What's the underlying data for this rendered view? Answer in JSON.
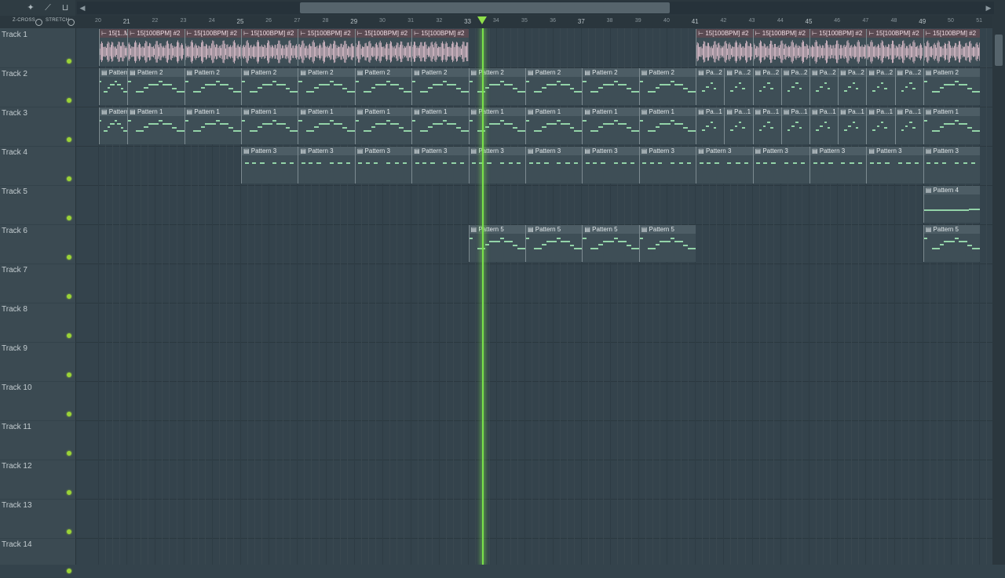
{
  "toolbar": {
    "tools": [
      "magnet-icon",
      "pencil-icon",
      "slice-icon"
    ],
    "crossfade_label": "Z-CROSS",
    "stretch_label": "STRETCH"
  },
  "ruler": {
    "first_bar": 20,
    "last_bar": 51,
    "bar_labels": [
      "20",
      "21",
      "22",
      "23",
      "24",
      "25",
      "26",
      "27",
      "28",
      "29",
      "30",
      "31",
      "32",
      "33",
      "34",
      "35",
      "36",
      "37",
      "38",
      "39",
      "40",
      "41",
      "42",
      "43",
      "44",
      "45",
      "46",
      "47",
      "48",
      "49",
      "50",
      "51"
    ],
    "playhead_bar": 33.5
  },
  "scroll": {
    "thumb_start_bar": 27,
    "thumb_end_bar": 40
  },
  "tracks": [
    {
      "label": "Track 1"
    },
    {
      "label": "Track 2"
    },
    {
      "label": "Track 3"
    },
    {
      "label": "Track 4"
    },
    {
      "label": "Track 5"
    },
    {
      "label": "Track 6"
    },
    {
      "label": "Track 7"
    },
    {
      "label": "Track 8"
    },
    {
      "label": "Track 9"
    },
    {
      "label": "Track 10"
    },
    {
      "label": "Track 11"
    },
    {
      "label": "Track 12"
    },
    {
      "label": "Track 13"
    },
    {
      "label": "Track 14"
    }
  ],
  "clips": [
    {
      "track": 0,
      "start": 20,
      "end": 21,
      "title": "15[1..M] #2",
      "type": "audio"
    },
    {
      "track": 0,
      "start": 21,
      "end": 23,
      "title": "15[100BPM] #2",
      "type": "audio"
    },
    {
      "track": 0,
      "start": 23,
      "end": 25,
      "title": "15[100BPM] #2",
      "type": "audio"
    },
    {
      "track": 0,
      "start": 25,
      "end": 27,
      "title": "15[100BPM] #2",
      "type": "audio"
    },
    {
      "track": 0,
      "start": 27,
      "end": 29,
      "title": "15[100BPM] #2",
      "type": "audio"
    },
    {
      "track": 0,
      "start": 29,
      "end": 31,
      "title": "15[100BPM] #2",
      "type": "audio"
    },
    {
      "track": 0,
      "start": 31,
      "end": 33,
      "title": "15[100BPM] #2",
      "type": "audio"
    },
    {
      "track": 0,
      "start": 41,
      "end": 43,
      "title": "15[100BPM] #2",
      "type": "audio"
    },
    {
      "track": 0,
      "start": 43,
      "end": 45,
      "title": "15[100BPM] #2",
      "type": "audio"
    },
    {
      "track": 0,
      "start": 45,
      "end": 47,
      "title": "15[100BPM] #2",
      "type": "audio"
    },
    {
      "track": 0,
      "start": 47,
      "end": 49,
      "title": "15[100BPM] #2",
      "type": "audio"
    },
    {
      "track": 0,
      "start": 49,
      "end": 51,
      "title": "15[100BPM] #2",
      "type": "audio"
    },
    {
      "track": 1,
      "start": 20,
      "end": 21,
      "title": "Pattern 2",
      "type": "pattern",
      "pattern": "a"
    },
    {
      "track": 1,
      "start": 21,
      "end": 23,
      "title": "Pattern 2",
      "type": "pattern",
      "pattern": "a"
    },
    {
      "track": 1,
      "start": 23,
      "end": 25,
      "title": "Pattern 2",
      "type": "pattern",
      "pattern": "a"
    },
    {
      "track": 1,
      "start": 25,
      "end": 27,
      "title": "Pattern 2",
      "type": "pattern",
      "pattern": "a"
    },
    {
      "track": 1,
      "start": 27,
      "end": 29,
      "title": "Pattern 2",
      "type": "pattern",
      "pattern": "a"
    },
    {
      "track": 1,
      "start": 29,
      "end": 31,
      "title": "Pattern 2",
      "type": "pattern",
      "pattern": "a"
    },
    {
      "track": 1,
      "start": 31,
      "end": 33,
      "title": "Pattern 2",
      "type": "pattern",
      "pattern": "a"
    },
    {
      "track": 1,
      "start": 33,
      "end": 35,
      "title": "Pattern 2",
      "type": "pattern",
      "pattern": "a"
    },
    {
      "track": 1,
      "start": 35,
      "end": 37,
      "title": "Pattern 2",
      "type": "pattern",
      "pattern": "a"
    },
    {
      "track": 1,
      "start": 37,
      "end": 39,
      "title": "Pattern 2",
      "type": "pattern",
      "pattern": "a"
    },
    {
      "track": 1,
      "start": 39,
      "end": 41,
      "title": "Pattern 2",
      "type": "pattern",
      "pattern": "a"
    },
    {
      "track": 1,
      "start": 41,
      "end": 42,
      "title": "Pa...2",
      "type": "pattern",
      "pattern": "b"
    },
    {
      "track": 1,
      "start": 42,
      "end": 43,
      "title": "Pa...2",
      "type": "pattern",
      "pattern": "b"
    },
    {
      "track": 1,
      "start": 43,
      "end": 44,
      "title": "Pa...2",
      "type": "pattern",
      "pattern": "b"
    },
    {
      "track": 1,
      "start": 44,
      "end": 45,
      "title": "Pa...2",
      "type": "pattern",
      "pattern": "b"
    },
    {
      "track": 1,
      "start": 45,
      "end": 46,
      "title": "Pa...2",
      "type": "pattern",
      "pattern": "b"
    },
    {
      "track": 1,
      "start": 46,
      "end": 47,
      "title": "Pa...2",
      "type": "pattern",
      "pattern": "b"
    },
    {
      "track": 1,
      "start": 47,
      "end": 48,
      "title": "Pa...2",
      "type": "pattern",
      "pattern": "b"
    },
    {
      "track": 1,
      "start": 48,
      "end": 49,
      "title": "Pa...2",
      "type": "pattern",
      "pattern": "b"
    },
    {
      "track": 1,
      "start": 49,
      "end": 51,
      "title": "Pattern 2",
      "type": "pattern",
      "pattern": "a"
    },
    {
      "track": 2,
      "start": 20,
      "end": 21,
      "title": "Pattern 1",
      "type": "pattern",
      "pattern": "a"
    },
    {
      "track": 2,
      "start": 21,
      "end": 23,
      "title": "Pattern 1",
      "type": "pattern",
      "pattern": "a"
    },
    {
      "track": 2,
      "start": 23,
      "end": 25,
      "title": "Pattern 1",
      "type": "pattern",
      "pattern": "a"
    },
    {
      "track": 2,
      "start": 25,
      "end": 27,
      "title": "Pattern 1",
      "type": "pattern",
      "pattern": "a"
    },
    {
      "track": 2,
      "start": 27,
      "end": 29,
      "title": "Pattern 1",
      "type": "pattern",
      "pattern": "a"
    },
    {
      "track": 2,
      "start": 29,
      "end": 31,
      "title": "Pattern 1",
      "type": "pattern",
      "pattern": "a"
    },
    {
      "track": 2,
      "start": 31,
      "end": 33,
      "title": "Pattern 1",
      "type": "pattern",
      "pattern": "a"
    },
    {
      "track": 2,
      "start": 33,
      "end": 35,
      "title": "Pattern 1",
      "type": "pattern",
      "pattern": "a"
    },
    {
      "track": 2,
      "start": 35,
      "end": 37,
      "title": "Pattern 1",
      "type": "pattern",
      "pattern": "a"
    },
    {
      "track": 2,
      "start": 37,
      "end": 39,
      "title": "Pattern 1",
      "type": "pattern",
      "pattern": "a"
    },
    {
      "track": 2,
      "start": 39,
      "end": 41,
      "title": "Pattern 1",
      "type": "pattern",
      "pattern": "a"
    },
    {
      "track": 2,
      "start": 41,
      "end": 42,
      "title": "Pa...1",
      "type": "pattern",
      "pattern": "b"
    },
    {
      "track": 2,
      "start": 42,
      "end": 43,
      "title": "Pa...1",
      "type": "pattern",
      "pattern": "b"
    },
    {
      "track": 2,
      "start": 43,
      "end": 44,
      "title": "Pa...1",
      "type": "pattern",
      "pattern": "b"
    },
    {
      "track": 2,
      "start": 44,
      "end": 45,
      "title": "Pa...1",
      "type": "pattern",
      "pattern": "b"
    },
    {
      "track": 2,
      "start": 45,
      "end": 46,
      "title": "Pa...1",
      "type": "pattern",
      "pattern": "b"
    },
    {
      "track": 2,
      "start": 46,
      "end": 47,
      "title": "Pa...1",
      "type": "pattern",
      "pattern": "b"
    },
    {
      "track": 2,
      "start": 47,
      "end": 48,
      "title": "Pa...1",
      "type": "pattern",
      "pattern": "b"
    },
    {
      "track": 2,
      "start": 48,
      "end": 49,
      "title": "Pa...1",
      "type": "pattern",
      "pattern": "b"
    },
    {
      "track": 2,
      "start": 49,
      "end": 51,
      "title": "Pattern 1",
      "type": "pattern",
      "pattern": "a"
    },
    {
      "track": 3,
      "start": 25,
      "end": 27,
      "title": "Pattern 3",
      "type": "pattern",
      "pattern": "c"
    },
    {
      "track": 3,
      "start": 27,
      "end": 29,
      "title": "Pattern 3",
      "type": "pattern",
      "pattern": "c"
    },
    {
      "track": 3,
      "start": 29,
      "end": 31,
      "title": "Pattern 3",
      "type": "pattern",
      "pattern": "c"
    },
    {
      "track": 3,
      "start": 31,
      "end": 33,
      "title": "Pattern 3",
      "type": "pattern",
      "pattern": "c"
    },
    {
      "track": 3,
      "start": 33,
      "end": 35,
      "title": "Pattern 3",
      "type": "pattern",
      "pattern": "c"
    },
    {
      "track": 3,
      "start": 35,
      "end": 37,
      "title": "Pattern 3",
      "type": "pattern",
      "pattern": "c"
    },
    {
      "track": 3,
      "start": 37,
      "end": 39,
      "title": "Pattern 3",
      "type": "pattern",
      "pattern": "c"
    },
    {
      "track": 3,
      "start": 39,
      "end": 41,
      "title": "Pattern 3",
      "type": "pattern",
      "pattern": "c"
    },
    {
      "track": 3,
      "start": 41,
      "end": 43,
      "title": "Pattern 3",
      "type": "pattern",
      "pattern": "c"
    },
    {
      "track": 3,
      "start": 43,
      "end": 45,
      "title": "Pattern 3",
      "type": "pattern",
      "pattern": "c"
    },
    {
      "track": 3,
      "start": 45,
      "end": 47,
      "title": "Pattern 3",
      "type": "pattern",
      "pattern": "c"
    },
    {
      "track": 3,
      "start": 47,
      "end": 49,
      "title": "Pattern 3",
      "type": "pattern",
      "pattern": "c"
    },
    {
      "track": 3,
      "start": 49,
      "end": 51,
      "title": "Pattern 3",
      "type": "pattern",
      "pattern": "c"
    },
    {
      "track": 4,
      "start": 49,
      "end": 51,
      "title": "Pattern 4",
      "type": "pattern",
      "pattern": "d"
    },
    {
      "track": 5,
      "start": 33,
      "end": 35,
      "title": "Pattern 5",
      "type": "pattern",
      "pattern": "a"
    },
    {
      "track": 5,
      "start": 35,
      "end": 37,
      "title": "Pattern 5",
      "type": "pattern",
      "pattern": "a"
    },
    {
      "track": 5,
      "start": 37,
      "end": 39,
      "title": "Pattern 5",
      "type": "pattern",
      "pattern": "a"
    },
    {
      "track": 5,
      "start": 39,
      "end": 41,
      "title": "Pattern 5",
      "type": "pattern",
      "pattern": "a"
    },
    {
      "track": 5,
      "start": 49,
      "end": 51,
      "title": "Pattern 5",
      "type": "pattern",
      "pattern": "a"
    }
  ],
  "colors": {
    "playhead": "#79e04a",
    "note": "#93d3a8",
    "audio_wave": "#e8c6d3",
    "track_dot": "#9bd337"
  }
}
